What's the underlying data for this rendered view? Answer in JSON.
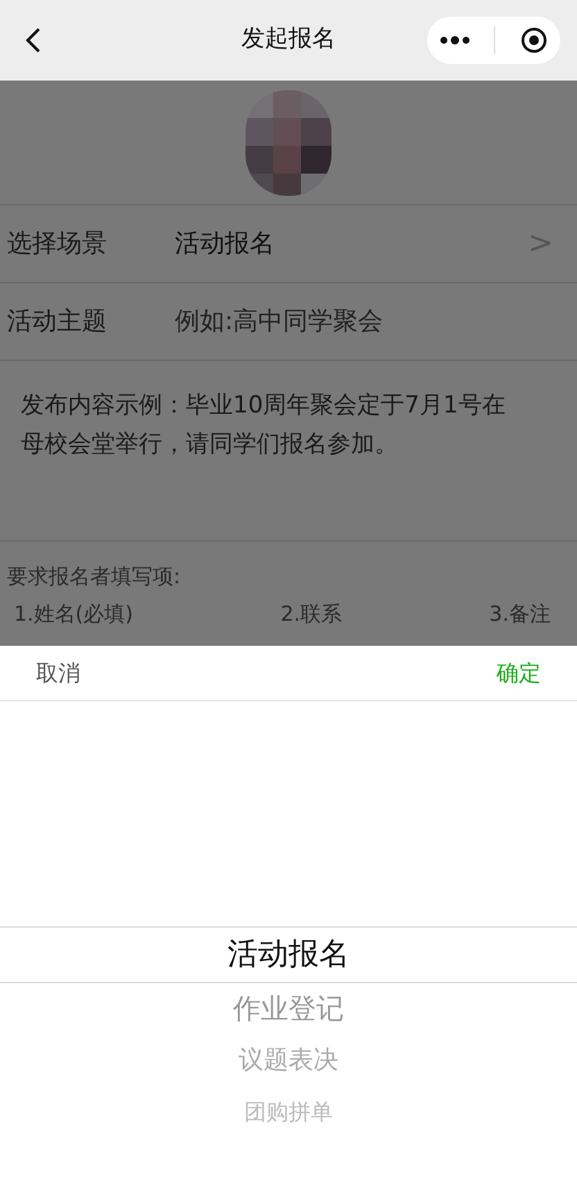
{
  "nav": {
    "title": "发起报名"
  },
  "form": {
    "rows": [
      {
        "label": "选择场景",
        "value": "活动报名",
        "chevron": ">"
      },
      {
        "label": "活动主题",
        "placeholder": "例如:高中同学聚会"
      }
    ],
    "content_placeholder": "发布内容示例：毕业10周年聚会定于7月1号在母校会堂举行，请同学们报名参加。",
    "fields_title": "要求报名者填写项:",
    "fields": [
      "1.姓名(必填)",
      "2.联系",
      "3.备注"
    ]
  },
  "picker": {
    "cancel": "取消",
    "confirm": "确定",
    "options": [
      {
        "label": "活动报名",
        "selected": true
      },
      {
        "label": "作业登记",
        "selected": false
      },
      {
        "label": "议题表决",
        "selected": false
      },
      {
        "label": "团购拼单",
        "selected": false
      }
    ]
  }
}
